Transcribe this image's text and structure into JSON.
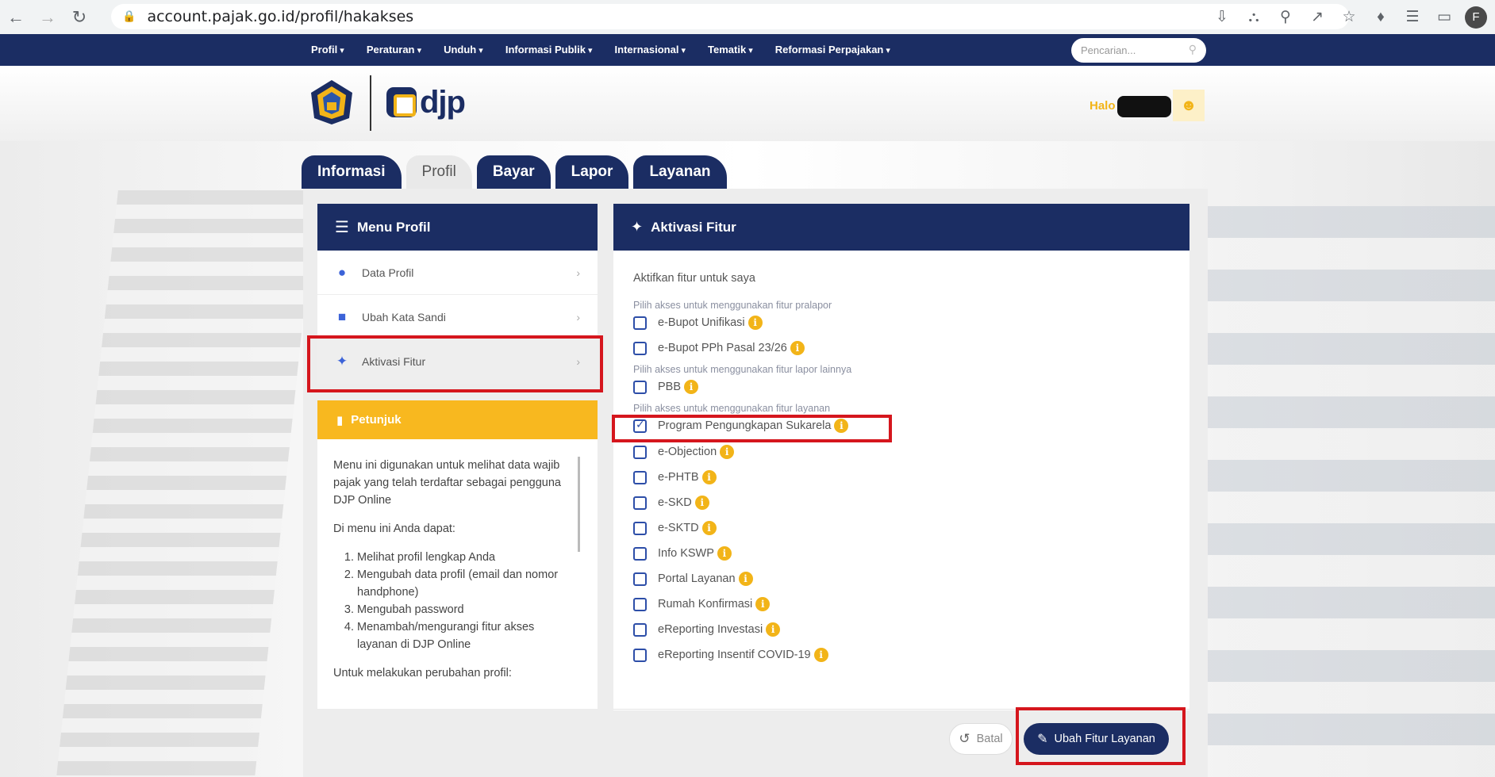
{
  "browser": {
    "url": "account.pajak.go.id/profil/hakakses",
    "profile_initial": "F"
  },
  "topnav": {
    "items": [
      "Profil",
      "Peraturan",
      "Unduh",
      "Informasi Publik",
      "Internasional",
      "Tematik",
      "Reformasi Perpajakan"
    ],
    "search_placeholder": "Pencarian..."
  },
  "header": {
    "logo_text": "djp",
    "greeting": "Halo"
  },
  "tabs": [
    "Informasi",
    "Profil",
    "Bayar",
    "Lapor",
    "Layanan"
  ],
  "menu": {
    "title": "Menu Profil",
    "items": [
      {
        "label": "Data Profil"
      },
      {
        "label": "Ubah Kata Sandi"
      },
      {
        "label": "Aktivasi Fitur"
      }
    ]
  },
  "petunjuk": {
    "title": "Petunjuk",
    "p1": "Menu ini digunakan untuk melihat data wajib pajak yang telah terdaftar sebagai pengguna DJP Online",
    "p2": "Di menu ini Anda dapat:",
    "list": [
      "Melihat profil lengkap Anda",
      "Mengubah data profil (email dan nomor handphone)",
      "Mengubah password",
      "Menambah/mengurangi fitur akses layanan di DJP Online"
    ],
    "p3": "Untuk melakukan perubahan profil:"
  },
  "aktivasi": {
    "title": "Aktivasi Fitur",
    "intro": "Aktifkan fitur untuk saya",
    "sections": [
      "Pilih akses untuk menggunakan fitur pralapor",
      "Pilih akses untuk menggunakan fitur lapor lainnya",
      "Pilih akses untuk menggunakan fitur layanan"
    ],
    "options": [
      {
        "label": "e-Bupot Unifikasi",
        "checked": false
      },
      {
        "label": "e-Bupot PPh Pasal 23/26",
        "checked": false
      },
      {
        "label": "PBB",
        "checked": false
      },
      {
        "label": "Program Pengungkapan Sukarela",
        "checked": true
      },
      {
        "label": "e-Objection",
        "checked": false
      },
      {
        "label": "e-PHTB",
        "checked": false
      },
      {
        "label": "e-SKD",
        "checked": false
      },
      {
        "label": "e-SKTD",
        "checked": false
      },
      {
        "label": "Info KSWP",
        "checked": false
      },
      {
        "label": "Portal Layanan",
        "checked": false
      },
      {
        "label": "Rumah Konfirmasi",
        "checked": false
      },
      {
        "label": "eReporting Investasi",
        "checked": false
      },
      {
        "label": "eReporting Insentif COVID-19",
        "checked": false
      }
    ],
    "batal": "Batal",
    "ubah": "Ubah Fitur Layanan"
  },
  "colors": {
    "navy": "#1b2d63",
    "gold": "#f2b418",
    "highlight": "#d5161d"
  }
}
